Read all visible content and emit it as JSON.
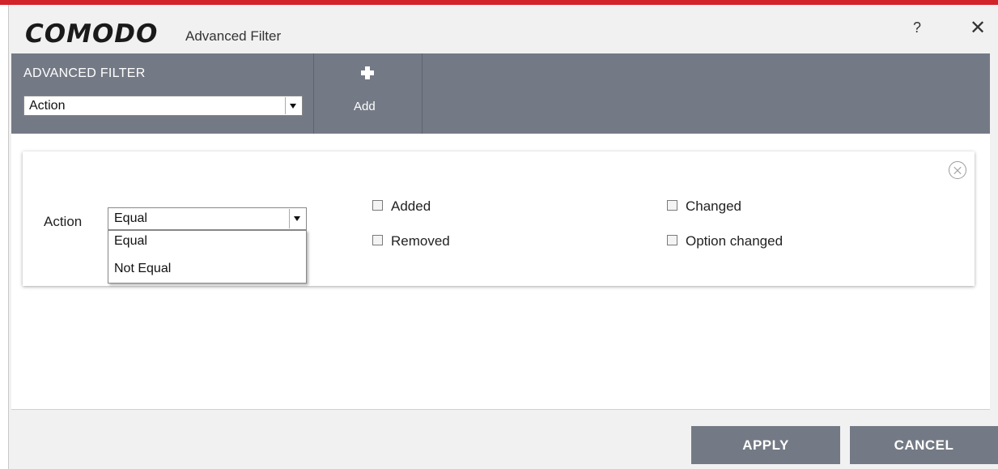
{
  "window": {
    "brand": "COMODO",
    "title": "Advanced Filter",
    "help": "?",
    "close": "✕"
  },
  "toolbar": {
    "filter_label": "ADVANCED FILTER",
    "filter_value": "Action",
    "add_label": "Add"
  },
  "condition": {
    "label": "Action",
    "operator_value": "Equal",
    "operator_options": [
      "Equal",
      "Not Equal"
    ],
    "checkboxes": [
      {
        "label": "Added",
        "checked": false
      },
      {
        "label": "Changed",
        "checked": false
      },
      {
        "label": "Removed",
        "checked": false
      },
      {
        "label": "Option changed",
        "checked": false
      }
    ]
  },
  "buttons": {
    "apply": "APPLY",
    "cancel": "CANCEL"
  },
  "colors": {
    "accent_red": "#d2222a",
    "toolbar_gray": "#747a85"
  }
}
